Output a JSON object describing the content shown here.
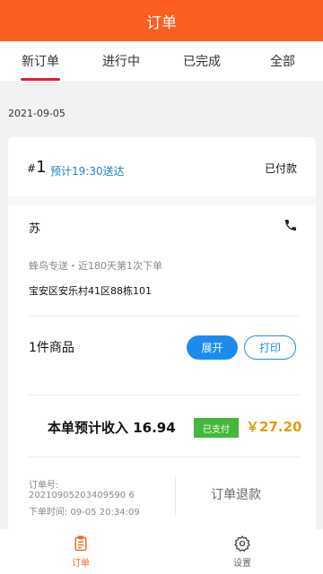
{
  "header": {
    "title": "订单"
  },
  "tabs": [
    {
      "label": "新订单"
    },
    {
      "label": "进行中"
    },
    {
      "label": "已完成"
    },
    {
      "label": "全部"
    }
  ],
  "date": "2021-09-05",
  "order": {
    "hash": "#",
    "number": "1",
    "eta": "预计19:30送达",
    "payment_status": "已付款",
    "customer": "苏",
    "info_line": "蜂鸟专送・近180天第1次下单",
    "address": "宝安区安乐村41区88栋101",
    "items_count": "1件商品",
    "expand_label": "展开",
    "print_label": "打印",
    "income_text": "本单预计收入 16.94",
    "paid_badge": "已支付",
    "price": "￥27.20",
    "order_no_label": "订单号:",
    "order_no": "20210905203409590 6",
    "order_time": "下单时间: 09-05 20:34:09",
    "refund_label": "订单退款"
  },
  "bottom_nav": [
    {
      "label": "订单",
      "icon": "clipboard-icon"
    },
    {
      "label": "设置",
      "icon": "gear-icon"
    }
  ],
  "colors": {
    "header": "#fb5e21",
    "accent_blue": "#1a8cf0",
    "price": "#e49a13",
    "paid": "#43b83a"
  }
}
